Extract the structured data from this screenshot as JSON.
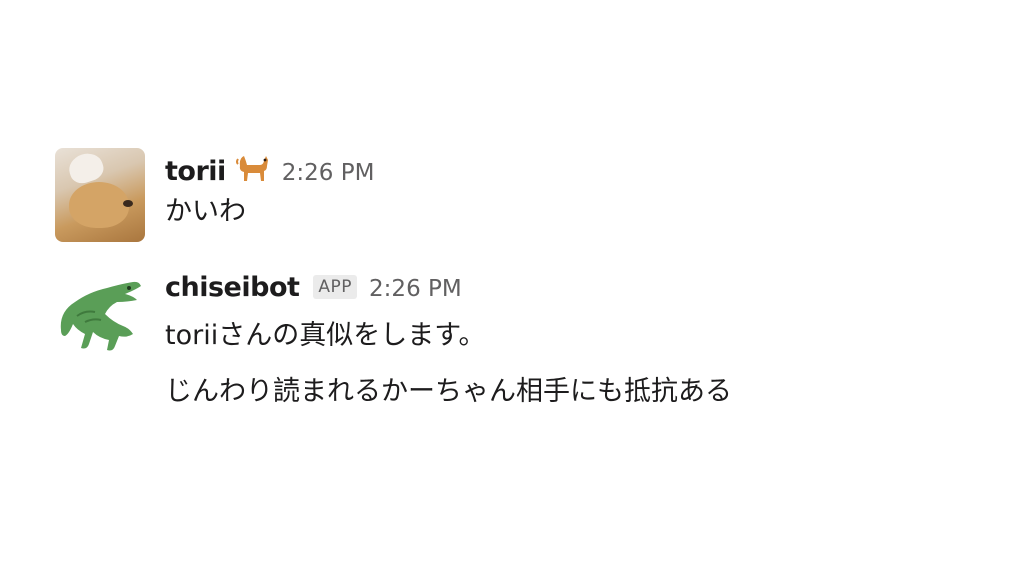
{
  "messages": [
    {
      "username": "torii",
      "emoji": "dog-emoji",
      "timestamp": "2:26 PM",
      "lines": [
        "かいわ"
      ]
    },
    {
      "username": "chiseibot",
      "badge": "APP",
      "timestamp": "2:26 PM",
      "lines": [
        "toriiさんの真似をします。",
        "じんわり読まれるかーちゃん相手にも抵抗ある"
      ]
    }
  ],
  "colors": {
    "text": "#1d1c1d",
    "muted": "#616061",
    "crocodile": "#5a9e57",
    "badge_bg": "#ebebeb"
  }
}
